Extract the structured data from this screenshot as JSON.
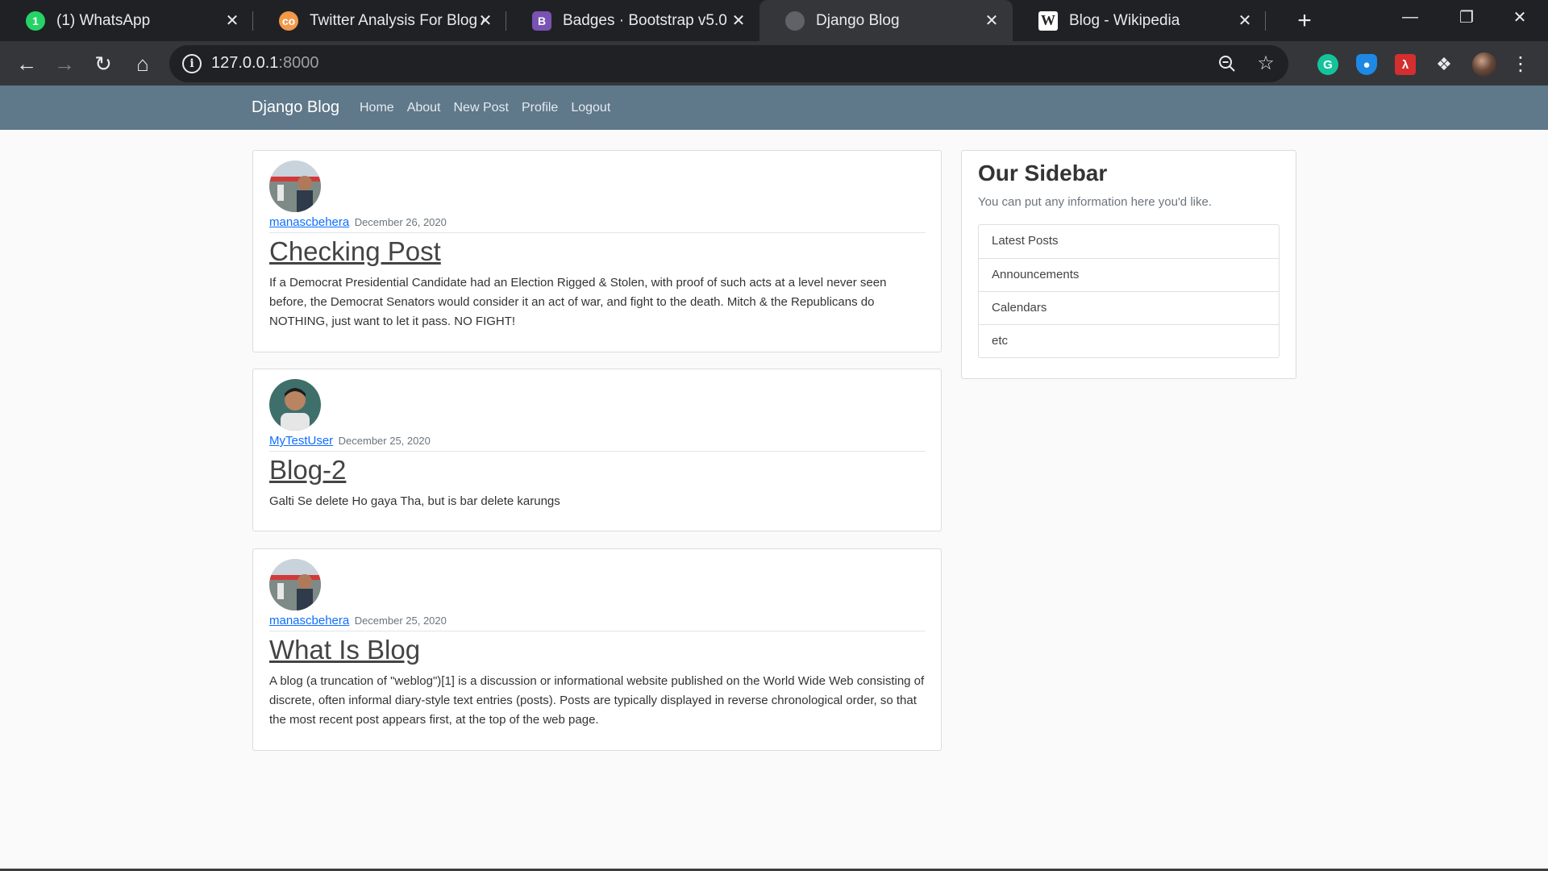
{
  "browser": {
    "tabs": [
      {
        "title": "(1) WhatsApp",
        "favicon": "whatsapp-icon",
        "favicon_text": "1"
      },
      {
        "title": "Twitter Analysis For Blog API",
        "favicon": "coursera-icon",
        "favicon_text": "co"
      },
      {
        "title": "Badges · Bootstrap v5.0",
        "favicon": "bootstrap-icon",
        "favicon_text": "B"
      },
      {
        "title": "Django Blog",
        "favicon": "globe-icon",
        "favicon_text": ""
      },
      {
        "title": "Blog - Wikipedia",
        "favicon": "wikipedia-icon",
        "favicon_text": "W"
      }
    ],
    "active_tab": 3,
    "address": {
      "host": "127.0.0.1",
      "port": ":8000"
    }
  },
  "navbar": {
    "brand": "Django Blog",
    "links": [
      "Home",
      "About",
      "New Post",
      "Profile",
      "Logout"
    ]
  },
  "posts": [
    {
      "author": "manascbehera",
      "date": "December 26, 2020",
      "title": "Checking Post",
      "body": "If a Democrat Presidential Candidate had an Election Rigged & Stolen, with proof of such acts at a level never seen before, the Democrat Senators would consider it an act of war, and fight to the death. Mitch & the Republicans do NOTHING, just want to let it pass. NO FIGHT!"
    },
    {
      "author": "MyTestUser",
      "date": "December 25, 2020",
      "title": "Blog-2",
      "body": "Galti Se delete Ho gaya Tha, but is bar delete karungs"
    },
    {
      "author": "manascbehera",
      "date": "December 25, 2020",
      "title": "What Is Blog",
      "body": "A blog (a truncation of \"weblog\")[1] is a discussion or informational website published on the World Wide Web consisting of discrete, often informal diary-style text entries (posts). Posts are typically displayed in reverse chronological order, so that the most recent post appears first, at the top of the web page."
    }
  ],
  "sidebar": {
    "title": "Our Sidebar",
    "subtitle": "You can put any information here you'd like.",
    "items": [
      "Latest Posts",
      "Announcements",
      "Calendars",
      "etc"
    ]
  },
  "colors": {
    "navbar": "#5f788a",
    "link": "#0d6efd",
    "chrome_dark": "#202124",
    "chrome_toolbar": "#35363a"
  }
}
